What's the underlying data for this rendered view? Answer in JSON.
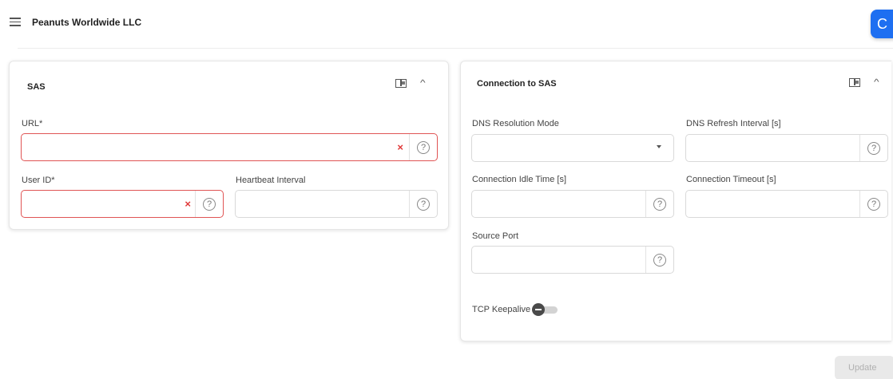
{
  "header": {
    "title": "Peanuts Worldwide LLC",
    "menu_icon": "hamburger-menu-icon",
    "refresh_icon": "refresh-icon",
    "refresh_glyph": "C"
  },
  "sas_panel": {
    "title": "SAS",
    "url": {
      "label": "URL*",
      "value": "",
      "clear_glyph": "×",
      "help_glyph": "?"
    },
    "user_id": {
      "label": "User ID*",
      "value": "",
      "clear_glyph": "×",
      "help_glyph": "?"
    },
    "heartbeat": {
      "label": "Heartbeat Interval",
      "value": "",
      "help_glyph": "?"
    }
  },
  "connection_panel": {
    "title": "Connection to SAS",
    "dns_resolution_mode": {
      "label": "DNS Resolution Mode",
      "value": ""
    },
    "dns_refresh_interval": {
      "label": "DNS Refresh Interval [s]",
      "value": "",
      "help_glyph": "?"
    },
    "connection_idle_time": {
      "label": "Connection Idle Time [s]",
      "value": "",
      "help_glyph": "?"
    },
    "connection_timeout": {
      "label": "Connection Timeout [s]",
      "value": "",
      "help_glyph": "?"
    },
    "source_port": {
      "label": "Source Port",
      "value": "",
      "help_glyph": "?"
    },
    "tcp_keepalive": {
      "label": "TCP Keepalive",
      "enabled": false
    }
  },
  "footer": {
    "update_label": "Update",
    "update_disabled": true
  },
  "colors": {
    "accent": "#1e6ff1",
    "error": "#e05454",
    "disabled_bg": "#e9e9e9",
    "disabled_text": "#b0b0b0"
  }
}
